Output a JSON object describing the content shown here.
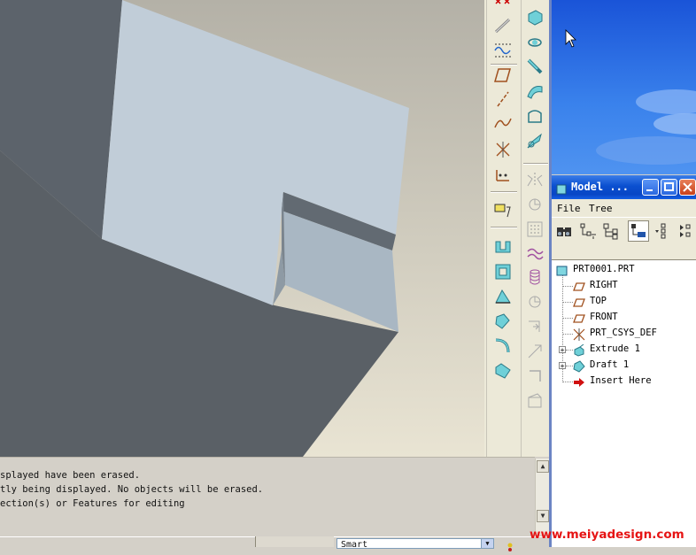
{
  "messages": {
    "line1": "splayed have been erased.",
    "line2": "tly being displayed. No objects will be erased.",
    "line3": "ection(s) or Features for editing"
  },
  "status": {
    "filter_value": "Smart"
  },
  "model_tree": {
    "title": "Model ...",
    "menu_file": "File",
    "menu_tree": "Tree",
    "nodes": [
      {
        "label": "PRT0001.PRT",
        "icon": "part-icon"
      },
      {
        "label": "RIGHT",
        "icon": "datum-plane-icon"
      },
      {
        "label": "TOP",
        "icon": "datum-plane-icon"
      },
      {
        "label": "FRONT",
        "icon": "datum-plane-icon"
      },
      {
        "label": "PRT_CSYS_DEF",
        "icon": "csys-icon"
      },
      {
        "label": "Extrude 1",
        "icon": "extrude-icon"
      },
      {
        "label": "Draft 1",
        "icon": "draft-icon"
      },
      {
        "label": "Insert Here",
        "icon": "insert-arrow-icon"
      }
    ]
  },
  "watermark": "www.meiyadesign.com",
  "colors": {
    "viewport_bg_top": "#b5b2a8",
    "viewport_bg_bottom": "#e6e1cf",
    "model_light": "#c0ccd8",
    "model_dark": "#5a6066",
    "titlebar_blue": "#0a4fd0",
    "watermark_red": "#e61414"
  }
}
